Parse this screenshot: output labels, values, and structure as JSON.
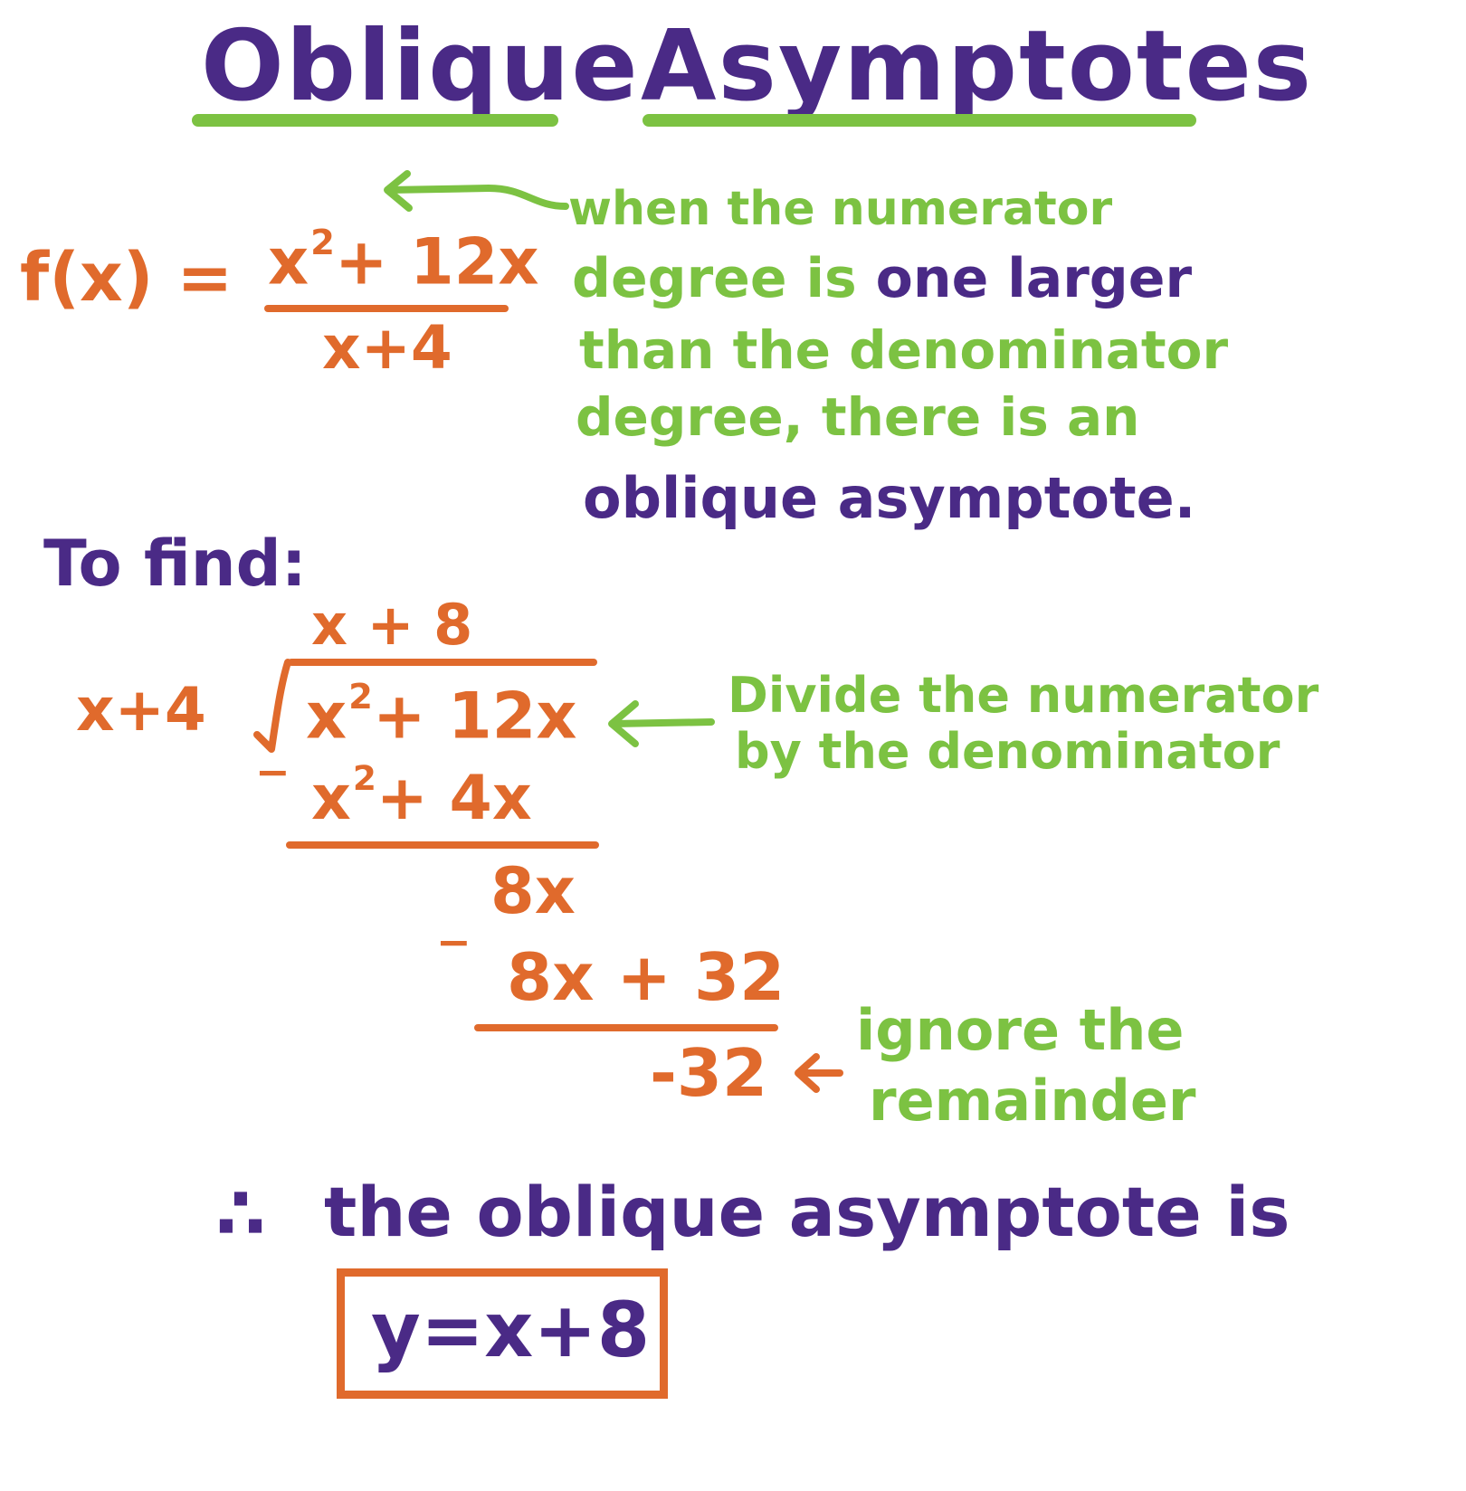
{
  "title": {
    "word1": "Oblique",
    "word2": "Asymptotes"
  },
  "function": {
    "lhs": "f(x) =",
    "num_base": "x",
    "num_exp": "2",
    "num_rest": "+ 12x",
    "den": "x+4"
  },
  "note1": {
    "line1": "when the numerator",
    "line2a": "degree is",
    "line2b": "one larger",
    "line3": "than the denominator",
    "line4": "degree, there is an",
    "line5": "oblique asymptote."
  },
  "to_find": "To find:",
  "division": {
    "quotient": "x + 8",
    "divisor": "x+4",
    "dividend_base": "x",
    "dividend_exp": "2",
    "dividend_rest": "+ 12x",
    "minus1": "−",
    "sub1_base": "x",
    "sub1_exp": "2",
    "sub1_rest": "+ 4x",
    "rem1": "8x",
    "minus2": "−",
    "sub2": "8x + 32",
    "remainder": "-32"
  },
  "note2": {
    "line1": "Divide the numerator",
    "line2": "by the denominator"
  },
  "note3": {
    "line1": "ignore the",
    "line2": "remainder"
  },
  "conclusion": {
    "therefore": "∴",
    "text": "the oblique asymptote is"
  },
  "answer": "y=x+8",
  "colors": {
    "purple": "#4a2a86",
    "orange": "#e06a2c",
    "green": "#7cc242"
  }
}
